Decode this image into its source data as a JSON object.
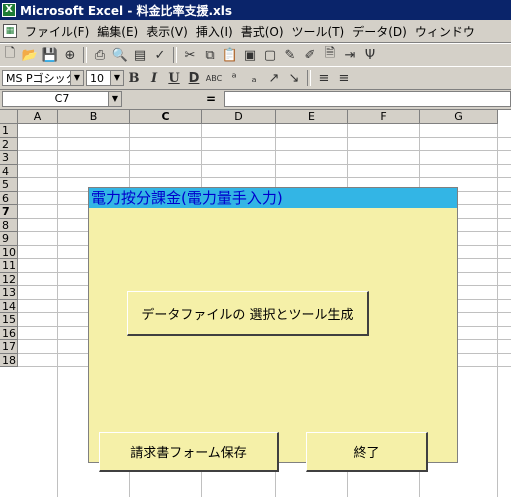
{
  "window": {
    "title": "Microsoft Excel - 料金比率支援.xls"
  },
  "menu": [
    "ファイル(F)",
    "編集(E)",
    "表示(V)",
    "挿入(I)",
    "書式(O)",
    "ツール(T)",
    "データ(D)",
    "ウィンドウ"
  ],
  "toolbar2": {
    "font_name": "MS Pゴシック",
    "font_size": "10"
  },
  "formula_bar": {
    "name_box": "C7",
    "equals": "="
  },
  "sheet": {
    "columns": [
      "A",
      "B",
      "C",
      "D",
      "E",
      "F",
      "G"
    ],
    "rows": [
      "1",
      "2",
      "3",
      "4",
      "5",
      "6",
      "7",
      "8",
      "9",
      "10",
      "11",
      "12",
      "13",
      "14",
      "15",
      "16",
      "17",
      "18"
    ],
    "selected_column": "C",
    "selected_row": "7"
  },
  "form": {
    "title": "電力按分課金(電力量手入力)",
    "generate_button": "データファイルの 選択とツール生成",
    "save_button": "請求書フォーム保存",
    "exit_button": "終了"
  },
  "colors": {
    "titlebar": "#0a246a",
    "form_background": "#f5f0a8",
    "form_title_background": "#33b5e5",
    "form_title_text": "#0000cc"
  }
}
